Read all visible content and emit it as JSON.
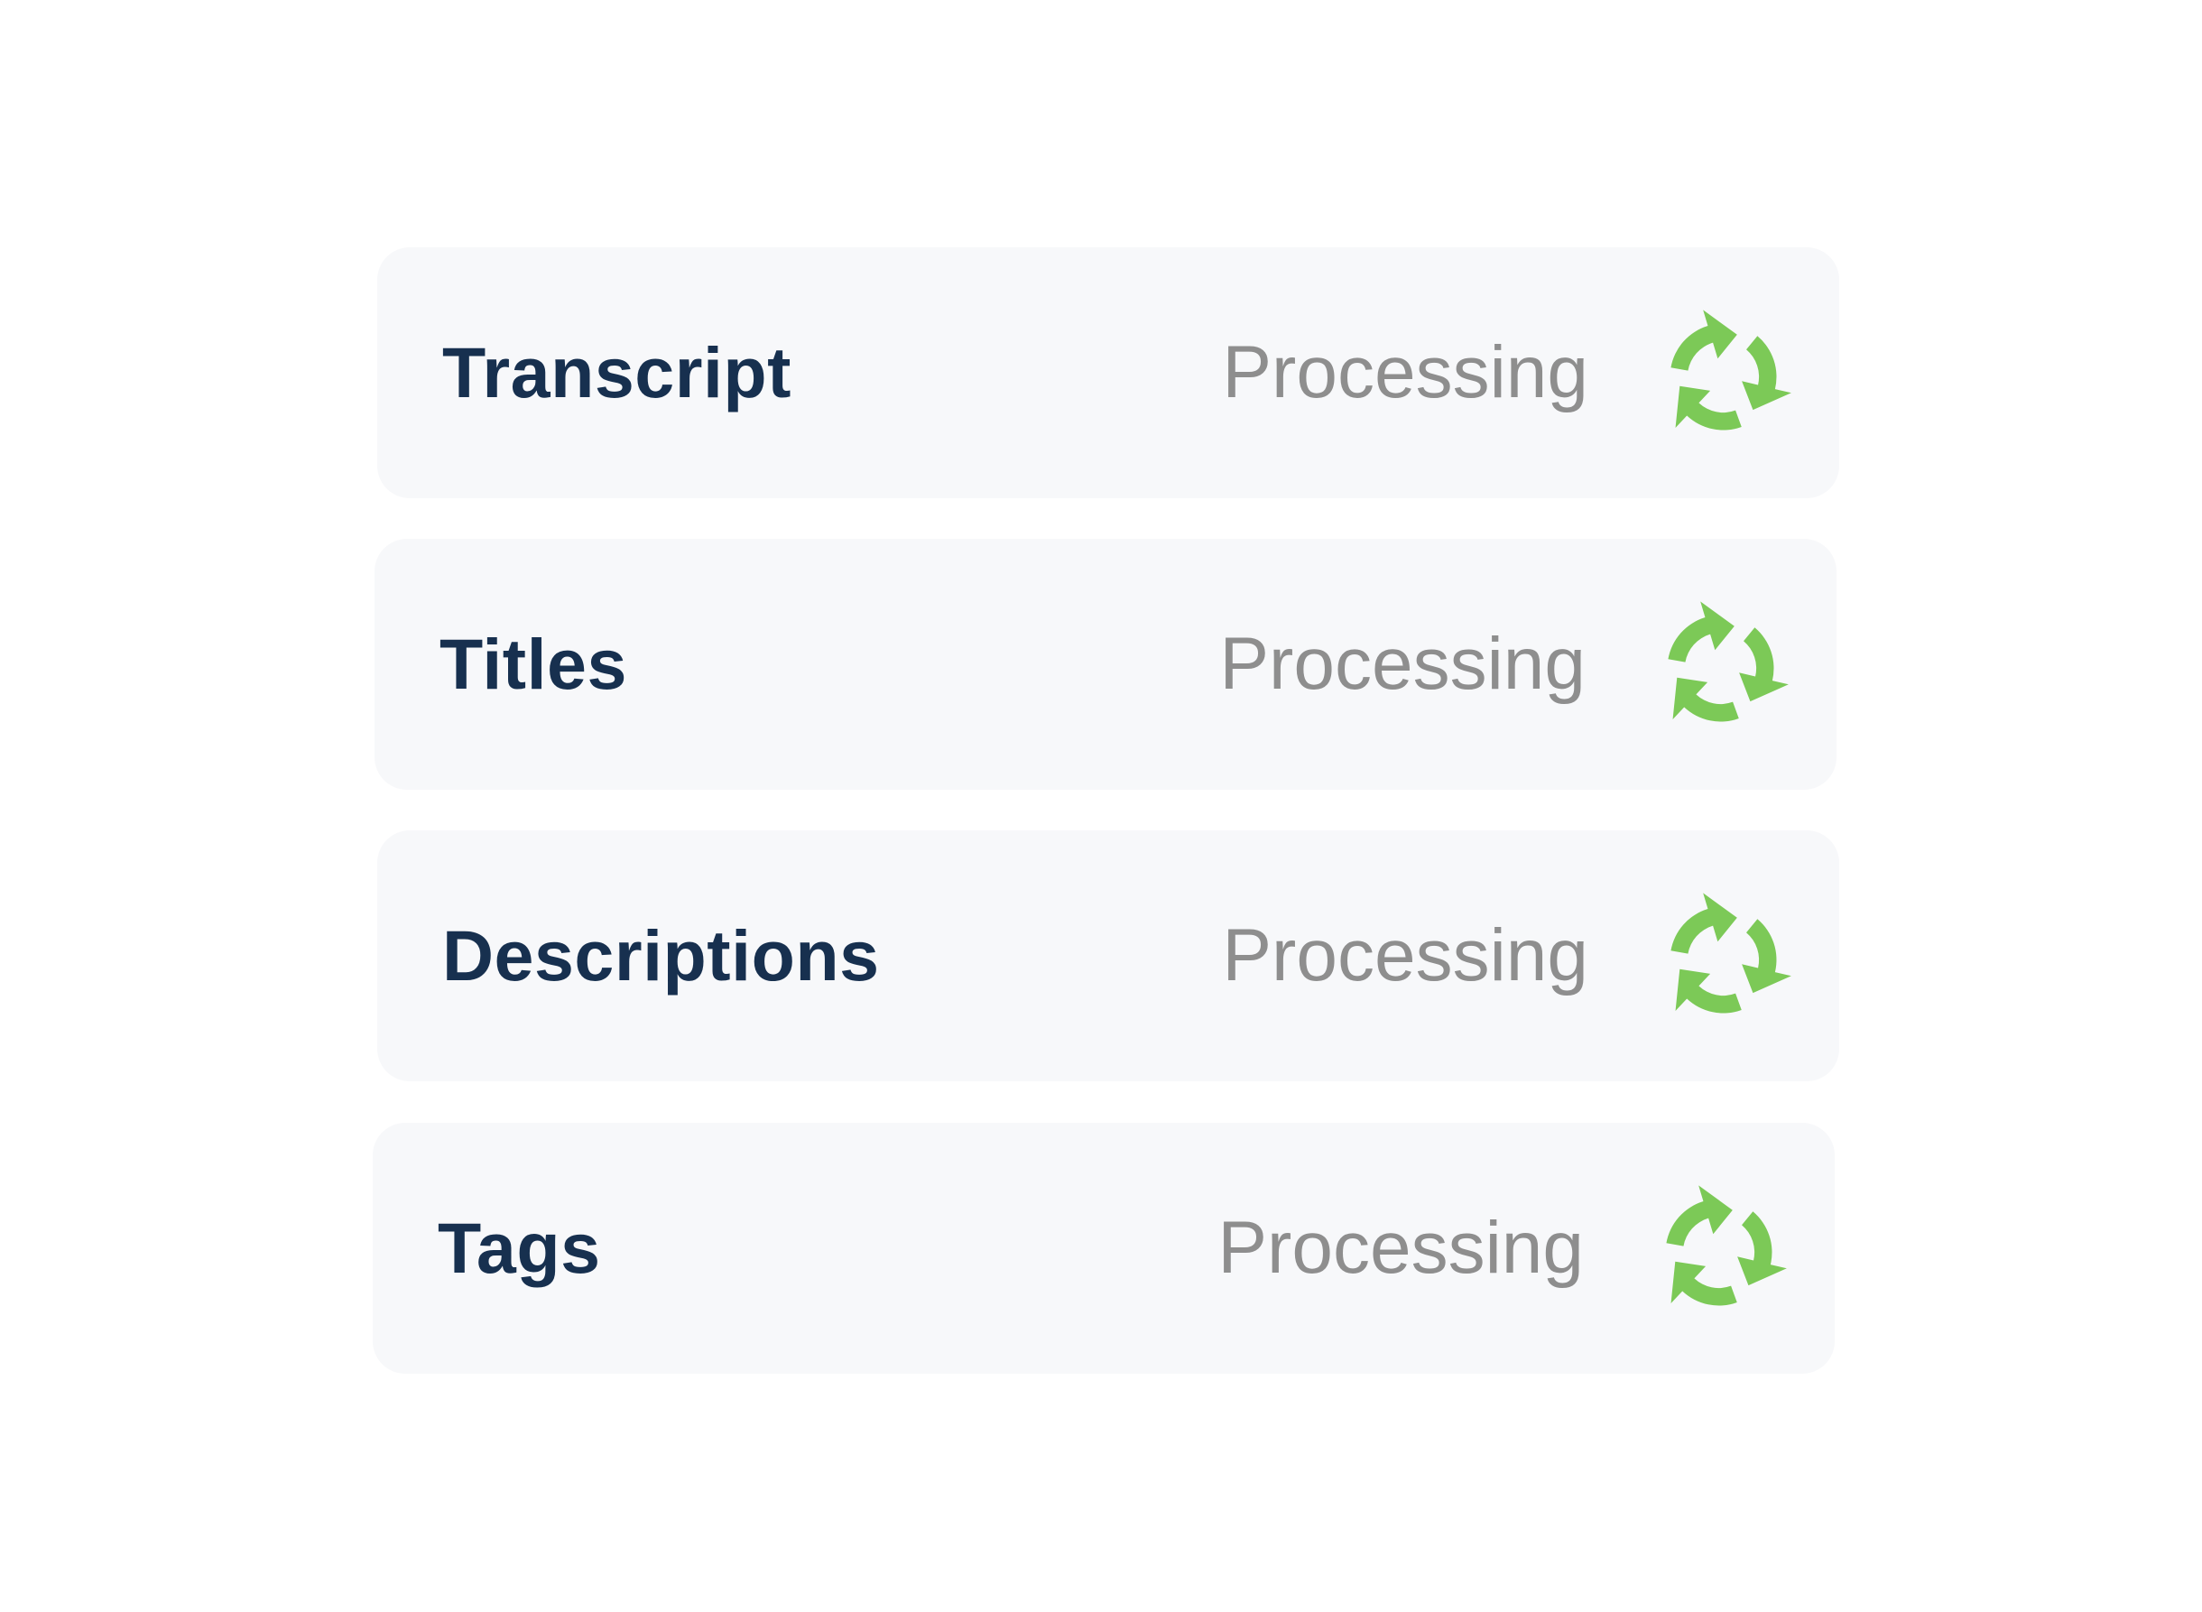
{
  "colors": {
    "row_background": "#f7f8fa",
    "task_name": "#17304f",
    "status_text": "#8e8e8e",
    "icon": "#7cc957"
  },
  "tasks": [
    {
      "name": "Transcript",
      "status": "Processing",
      "icon": "refresh-icon"
    },
    {
      "name": "Titles",
      "status": "Processing",
      "icon": "refresh-icon"
    },
    {
      "name": "Descriptions",
      "status": "Processing",
      "icon": "refresh-icon"
    },
    {
      "name": "Tags",
      "status": "Processing",
      "icon": "refresh-icon"
    }
  ]
}
